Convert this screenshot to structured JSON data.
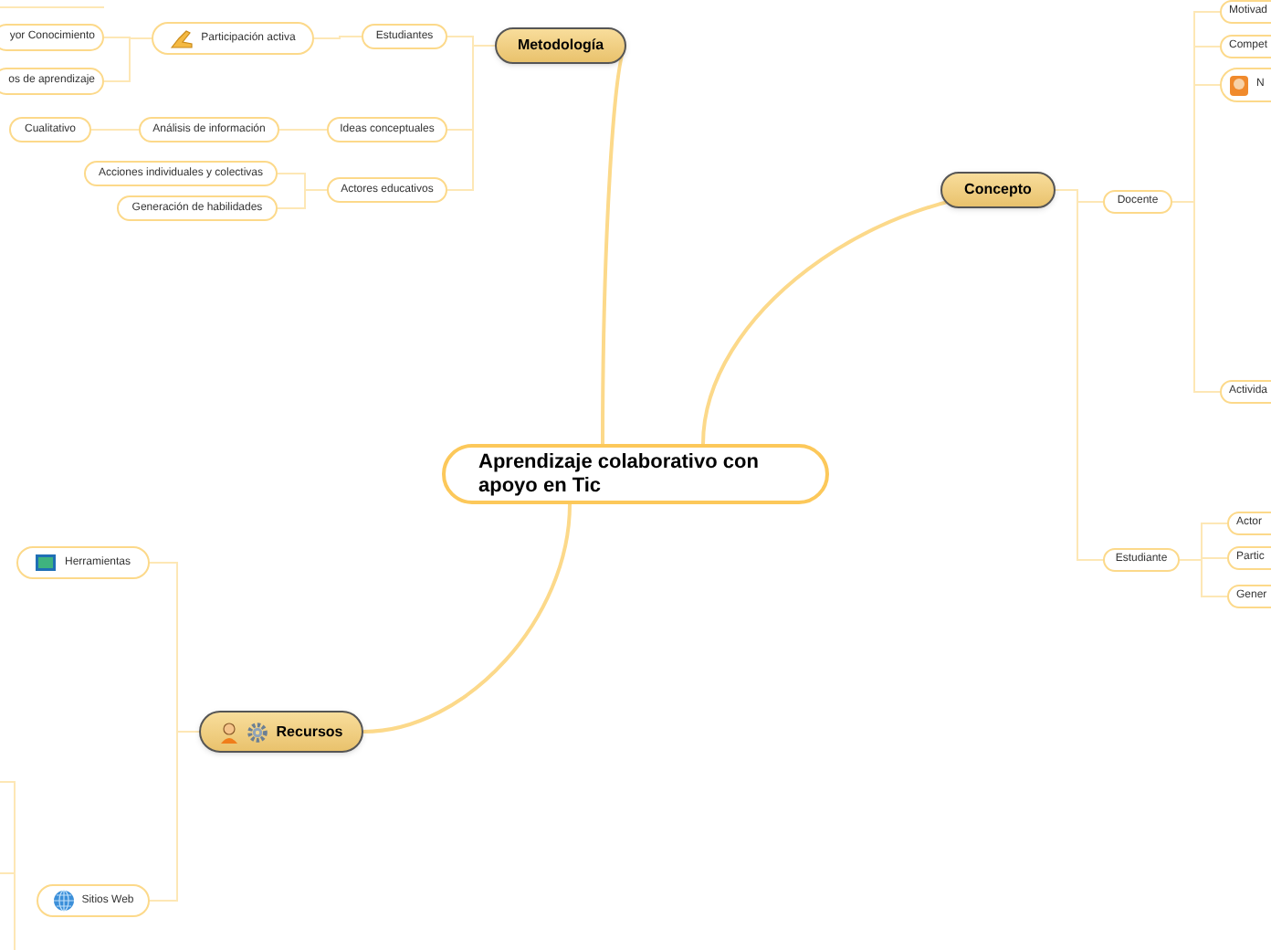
{
  "mind_map": {
    "central_topic": {
      "label": "Aprendizaje colaborativo con apoyo en Tic",
      "children": [
        {
          "label": "Metodología",
          "children": [
            {
              "label": "Estudiantes",
              "children": [
                {
                  "label": "Participación activa",
                  "icons": [
                    {
                      "kind": "hand"
                    }
                  ],
                  "children": [
                    {
                      "label": "yor Conocimiento"
                    },
                    {
                      "label": "os de aprendizaje"
                    }
                  ]
                }
              ]
            },
            {
              "label": "Ideas conceptuales",
              "children": [
                {
                  "label": "Análisis de información",
                  "children": [
                    {
                      "label": "Cualitativo"
                    }
                  ]
                }
              ]
            },
            {
              "label": "Actores educativos",
              "children": [
                {
                  "label": "Acciones individuales y colectivas"
                },
                {
                  "label": "Generación de habilidades"
                }
              ]
            }
          ]
        },
        {
          "label": "Concepto",
          "children": [
            {
              "label": "Docente",
              "children": [
                {
                  "label": "Motivad"
                },
                {
                  "label": "Compet"
                },
                {
                  "label": "N",
                  "icons": [
                    {
                      "kind": "avatar"
                    }
                  ]
                },
                {
                  "label": "Activida"
                }
              ]
            },
            {
              "label": "Estudiante",
              "children": [
                {
                  "label": "Actor"
                },
                {
                  "label": "Partic"
                },
                {
                  "label": "Gener"
                }
              ]
            }
          ]
        },
        {
          "label": "Recursos",
          "icons": [
            {
              "kind": "person"
            },
            {
              "kind": "gear"
            }
          ],
          "children": [
            {
              "label": "Herramientas",
              "icons": [
                {
                  "kind": "screen"
                }
              ]
            },
            {
              "label": "Sitios Web",
              "icons": [
                {
                  "kind": "globe"
                }
              ]
            }
          ]
        }
      ]
    }
  }
}
